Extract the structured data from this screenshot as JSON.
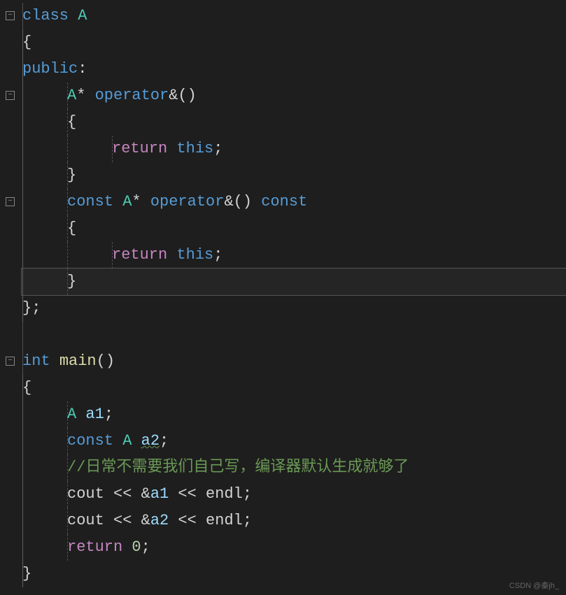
{
  "code": {
    "lines": [
      {
        "t": [
          {
            "c": "kw",
            "s": "class"
          },
          {
            "c": "op",
            "s": " "
          },
          {
            "c": "type",
            "s": "A"
          }
        ],
        "indent": 0,
        "fold": true
      },
      {
        "t": [
          {
            "c": "op",
            "s": "{"
          }
        ],
        "indent": 0
      },
      {
        "t": [
          {
            "c": "kw",
            "s": "public"
          },
          {
            "c": "op",
            "s": ":"
          }
        ],
        "indent": 0
      },
      {
        "t": [
          {
            "c": "type",
            "s": "A"
          },
          {
            "c": "op",
            "s": "* "
          },
          {
            "c": "kw",
            "s": "operator"
          },
          {
            "c": "op",
            "s": "&()"
          }
        ],
        "indent": 1,
        "fold": true
      },
      {
        "t": [
          {
            "c": "op",
            "s": "{"
          }
        ],
        "indent": 1
      },
      {
        "t": [
          {
            "c": "ret",
            "s": "return"
          },
          {
            "c": "op",
            "s": " "
          },
          {
            "c": "kw",
            "s": "this"
          },
          {
            "c": "op",
            "s": ";"
          }
        ],
        "indent": 2
      },
      {
        "t": [
          {
            "c": "op",
            "s": "}"
          }
        ],
        "indent": 1
      },
      {
        "t": [
          {
            "c": "kw",
            "s": "const"
          },
          {
            "c": "op",
            "s": " "
          },
          {
            "c": "type",
            "s": "A"
          },
          {
            "c": "op",
            "s": "* "
          },
          {
            "c": "kw",
            "s": "operator"
          },
          {
            "c": "op",
            "s": "&() "
          },
          {
            "c": "kw",
            "s": "const"
          }
        ],
        "indent": 1,
        "fold": true
      },
      {
        "t": [
          {
            "c": "op",
            "s": "{"
          }
        ],
        "indent": 1
      },
      {
        "t": [
          {
            "c": "ret",
            "s": "return"
          },
          {
            "c": "op",
            "s": " "
          },
          {
            "c": "kw",
            "s": "this"
          },
          {
            "c": "op",
            "s": ";"
          }
        ],
        "indent": 2
      },
      {
        "t": [
          {
            "c": "op",
            "s": "}"
          }
        ],
        "indent": 1,
        "hl": true
      },
      {
        "t": [
          {
            "c": "op",
            "s": "};"
          }
        ],
        "indent": 0
      },
      {
        "t": [],
        "indent": 0
      },
      {
        "t": [
          {
            "c": "kw",
            "s": "int"
          },
          {
            "c": "op",
            "s": " "
          },
          {
            "c": "func",
            "s": "main"
          },
          {
            "c": "op",
            "s": "()"
          }
        ],
        "indent": 0,
        "fold": true
      },
      {
        "t": [
          {
            "c": "op",
            "s": "{"
          }
        ],
        "indent": 0
      },
      {
        "t": [
          {
            "c": "type",
            "s": "A"
          },
          {
            "c": "op",
            "s": " "
          },
          {
            "c": "var",
            "s": "a1"
          },
          {
            "c": "op",
            "s": ";"
          }
        ],
        "indent": 1
      },
      {
        "t": [
          {
            "c": "kw",
            "s": "const"
          },
          {
            "c": "op",
            "s": " "
          },
          {
            "c": "type",
            "s": "A"
          },
          {
            "c": "op",
            "s": " "
          },
          {
            "c": "var underline",
            "s": "a2"
          },
          {
            "c": "op",
            "s": ";"
          }
        ],
        "indent": 1
      },
      {
        "t": [
          {
            "c": "comment",
            "s": "//日常不需要我们自己写，编译器默认生成就够了"
          }
        ],
        "indent": 1
      },
      {
        "t": [
          {
            "c": "ident",
            "s": "cout"
          },
          {
            "c": "op",
            "s": " << &"
          },
          {
            "c": "var",
            "s": "a1"
          },
          {
            "c": "op",
            "s": " << "
          },
          {
            "c": "ident",
            "s": "endl"
          },
          {
            "c": "op",
            "s": ";"
          }
        ],
        "indent": 1
      },
      {
        "t": [
          {
            "c": "ident",
            "s": "cout"
          },
          {
            "c": "op",
            "s": " << &"
          },
          {
            "c": "var",
            "s": "a2"
          },
          {
            "c": "op",
            "s": " << "
          },
          {
            "c": "ident",
            "s": "endl"
          },
          {
            "c": "op",
            "s": ";"
          }
        ],
        "indent": 1
      },
      {
        "t": [
          {
            "c": "ret",
            "s": "return"
          },
          {
            "c": "op",
            "s": " "
          },
          {
            "c": "num",
            "s": "0"
          },
          {
            "c": "op",
            "s": ";"
          }
        ],
        "indent": 1
      },
      {
        "t": [
          {
            "c": "op",
            "s": "}"
          }
        ],
        "indent": 0
      }
    ]
  },
  "watermark": "CSDN @秦jh_"
}
